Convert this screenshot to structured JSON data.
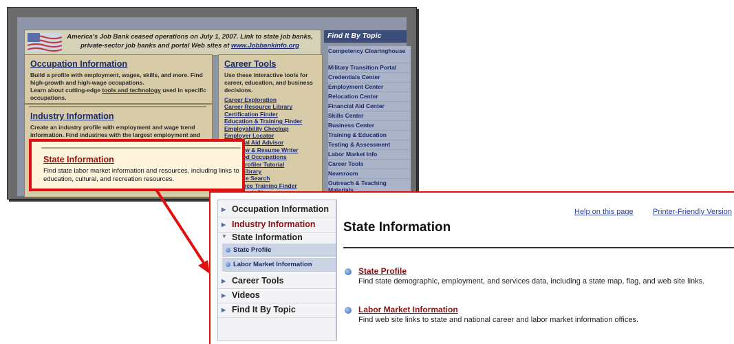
{
  "shot1": {
    "banner": {
      "text": "America's Job Bank ceased operations on July 1, 2007. Link to state job banks, private-sector job banks and portal Web sites at",
      "link": "www.Jobbankinfo.org"
    },
    "occupation": {
      "title": "Occupation Information",
      "text1": "Build a profile with employment, wages, skills, and more. Find high-growth and high-wage occupations.",
      "text2_pre": "Learn about cutting-edge ",
      "text2_link": "tools and technology",
      "text2_post": " used in specific occupations."
    },
    "industry": {
      "title": "Industry Information",
      "text": "Create an industry profile with employment and wage trend information. Find industries with the largest employment and those projected to grow the fastest."
    },
    "career_tools": {
      "title": "Career Tools",
      "text": "Use these interactive tools for career, education, and business decisions.",
      "links": [
        "Career Exploration",
        "Career Resource Library",
        "Certification Finder",
        "Education & Training Finder",
        "Employability Checkup",
        "Employer Locator",
        "Financial Aid Advisor",
        "Interview & Resume Writer",
        "Licensed Occupations",
        "Skills Profiler Tutorial",
        "Video Library",
        "Web Site Search",
        "Workforce Training Finder",
        "Job Search Planner"
      ]
    },
    "find_topic": {
      "header": "Find It By Topic",
      "items": [
        "Competency Clearinghouse",
        "Military Transition Portal",
        "Credentials Center",
        "Employment Center",
        "Relocation Center",
        "Financial Aid Center",
        "Skills Center",
        "Business Center",
        "Training & Education",
        "Testing & Assessment",
        "Labor Market Info",
        "Career Tools",
        "Newsroom",
        "Outreach & Teaching Materials"
      ]
    }
  },
  "callout": {
    "title": "State Information",
    "text": "Find state labor market information and resources, including links to education, cultural, and recreation resources."
  },
  "shot2": {
    "sidebar": {
      "items": [
        {
          "label": "Occupation Information"
        },
        {
          "label": "Industry Information"
        },
        {
          "label": "State Information"
        },
        {
          "label": "Career Tools"
        },
        {
          "label": "Videos"
        },
        {
          "label": "Find It By Topic"
        }
      ],
      "sub_items": [
        {
          "label": "State Profile"
        },
        {
          "label": "Labor Market Information"
        }
      ]
    },
    "main": {
      "help_link": "Help on this page",
      "print_link": "Printer-Friendly Version",
      "title": "State Information",
      "items": [
        {
          "title": "State Profile",
          "text": "Find state demographic, employment, and services data, including a state map, flag, and web site links."
        },
        {
          "title": "Labor Market Information",
          "text": "Find web site links to state and national career and labor market information offices."
        }
      ]
    }
  },
  "colors": {
    "highlight": "#e01010",
    "link": "#2b3fa6",
    "title_red": "#8b1212"
  }
}
